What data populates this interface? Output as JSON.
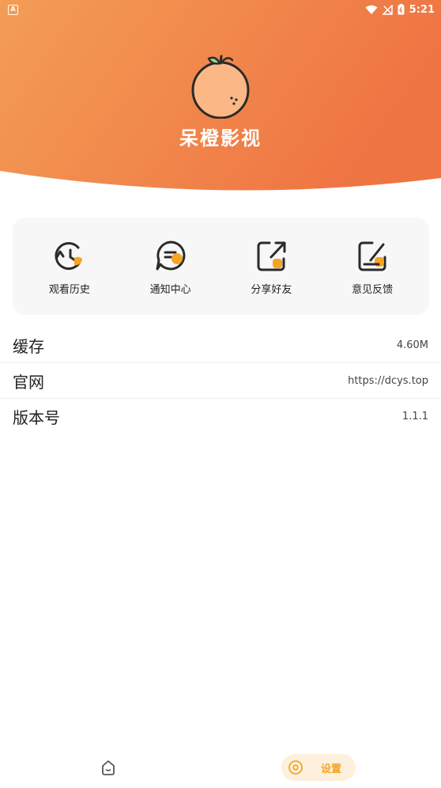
{
  "status_bar": {
    "left_icon": "A",
    "time": "5:21",
    "icons": [
      "wifi-icon",
      "no-signal-icon",
      "battery-icon"
    ]
  },
  "header": {
    "app_title": "呆橙影视",
    "logo": "orange-logo-icon",
    "gradient_start": "#f39a52",
    "gradient_end": "#ef7443"
  },
  "quick_actions": [
    {
      "label": "观看历史",
      "icon": "history-icon"
    },
    {
      "label": "通知中心",
      "icon": "message-icon"
    },
    {
      "label": "分享好友",
      "icon": "share-icon"
    },
    {
      "label": "意见反馈",
      "icon": "feedback-icon"
    }
  ],
  "settings": [
    {
      "title": "缓存",
      "value": "4.60M"
    },
    {
      "title": "官网",
      "value": "https://dcys.top"
    },
    {
      "title": "版本号",
      "value": "1.1.1"
    }
  ],
  "bottom_nav": {
    "home_icon": "home-icon",
    "settings_label": "设置",
    "settings_icon": "settings-icon",
    "active_color": "#f5a524"
  }
}
